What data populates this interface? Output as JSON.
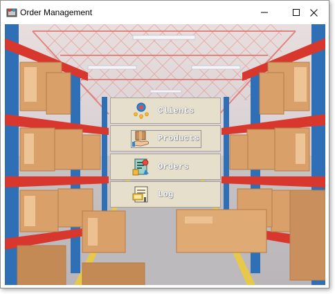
{
  "window": {
    "title": "Order Management",
    "icon": "app-window-icon"
  },
  "menu": {
    "items": [
      {
        "label": "Clients",
        "icon": "clients-icon"
      },
      {
        "label": "Products",
        "icon": "products-icon"
      },
      {
        "label": "Orders",
        "icon": "orders-icon"
      },
      {
        "label": "Log",
        "icon": "log-icon"
      }
    ],
    "focused_item": "Products"
  },
  "colors": {
    "button_bg": "#e6dfcc",
    "button_text": "#ffffff",
    "shelf_red": "#d8372e",
    "shelf_blue": "#2f6fb5",
    "box_tan": "#d9a06a"
  }
}
